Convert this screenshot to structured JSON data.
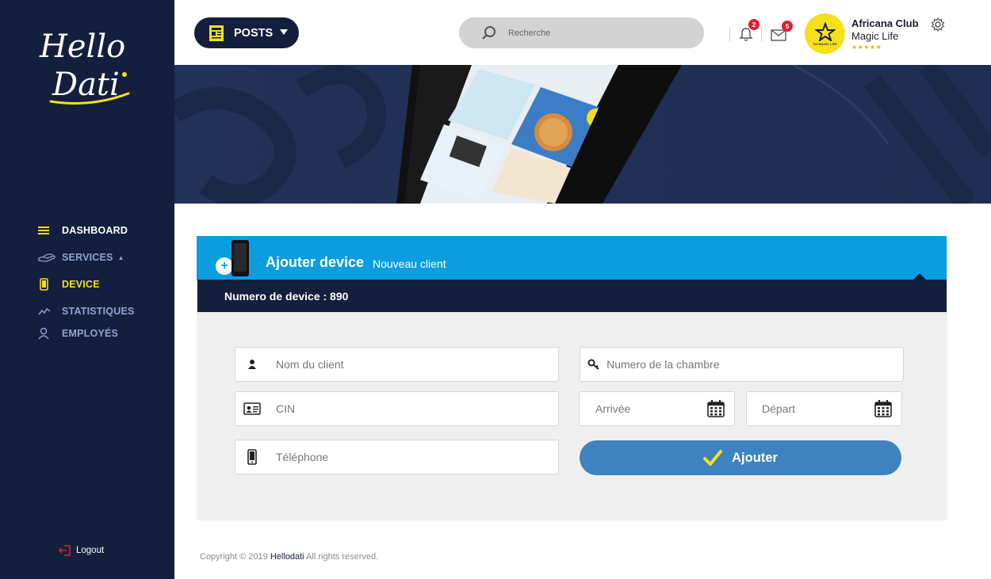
{
  "app": {
    "logo_text_line1": "Hello",
    "logo_text_line2": "Dati"
  },
  "sidebar": {
    "items": [
      {
        "label": "DASHBOARD",
        "icon": "list-icon"
      },
      {
        "label": "SERVICES",
        "icon": "hand-tray-icon"
      },
      {
        "label": "DEVICE",
        "icon": "phone-icon"
      },
      {
        "label": "STATISTIQUES",
        "icon": "trend-icon"
      },
      {
        "label": "EMPLOYÉS",
        "icon": "user-icon"
      }
    ],
    "logout_label": "Logout"
  },
  "header": {
    "posts_label": "POSTS",
    "search_placeholder": "Recherche",
    "notifications_count": "2",
    "messages_count": "5",
    "profile_name": "Africana Club",
    "profile_sub": "Magic Life",
    "profile_stars": "★★★★★",
    "avatar_caption": "TUI MAGIC LIFE"
  },
  "card": {
    "title": "Ajouter device",
    "subtitle": "Nouveau client",
    "device_number": "Numero de device : 890",
    "fields": {
      "nom_placeholder": "Nom du client",
      "cin_placeholder": "CIN",
      "telephone_placeholder": "Téléphone",
      "chambre_placeholder": "Numero de la chambre",
      "arrivee_placeholder": "Arrivée",
      "depart_placeholder": "Départ"
    },
    "submit_label": "Ajouter"
  },
  "footer": {
    "prefix": "Copyright © 2019 ",
    "brand": "Hellodati",
    "suffix": " All rights reserved."
  },
  "colors": {
    "sidebar": "#141f3d",
    "accent_yellow": "#f6e01c",
    "card_header_blue": "#0b9de0",
    "button_blue": "#3e82bf",
    "badge_red": "#e0202d"
  }
}
